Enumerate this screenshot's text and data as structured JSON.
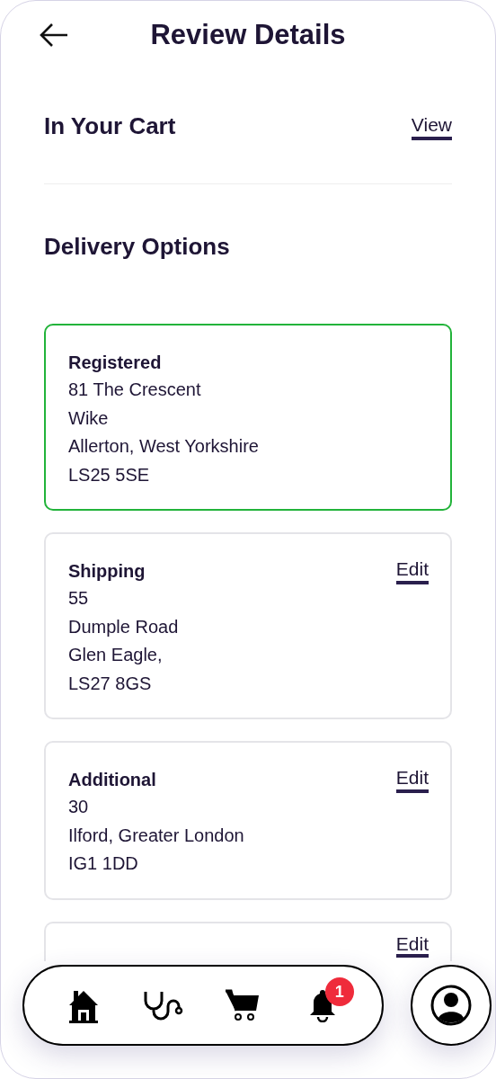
{
  "header": {
    "title": "Review Details"
  },
  "cart": {
    "title": "In Your Cart",
    "link": "View"
  },
  "delivery": {
    "title": "Delivery Options",
    "options": [
      {
        "name": "Registered",
        "lines": [
          "81 The Crescent",
          "Wike",
          "Allerton, West Yorkshire",
          "LS25 5SE"
        ],
        "selected": true
      },
      {
        "name": "Shipping",
        "lines": [
          "55",
          "Dumple Road",
          "Glen Eagle,",
          "LS27 8GS"
        ],
        "selected": false,
        "action": "Edit"
      },
      {
        "name": "Additional",
        "lines": [
          "30",
          "Ilford, Greater London",
          "IG1 1DD"
        ],
        "selected": false,
        "action": "Edit"
      },
      {
        "selected": false,
        "action": "Edit",
        "clipped": true
      }
    ]
  },
  "nav": {
    "items": [
      {
        "kind": "home"
      },
      {
        "kind": "health"
      },
      {
        "kind": "cart"
      },
      {
        "kind": "notifications",
        "badge": "1"
      }
    ]
  }
}
